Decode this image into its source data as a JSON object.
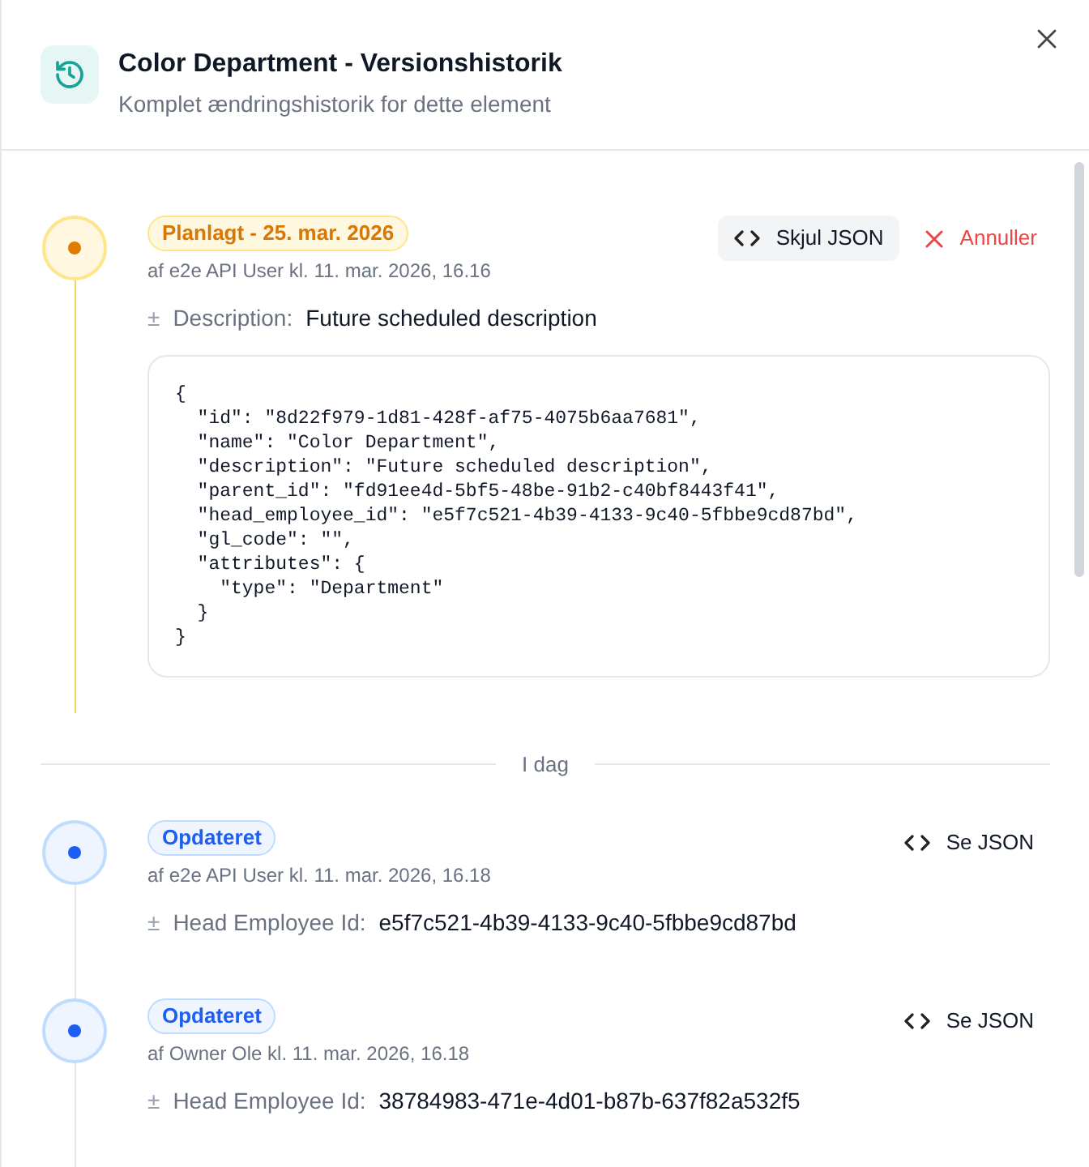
{
  "dialog": {
    "title": "Color Department - Versionshistorik",
    "subtitle": "Komplet ændringshistorik for dette element"
  },
  "timeline": [
    {
      "kind": "scheduled",
      "badge": "Planlagt - 25. mar. 2026",
      "byline": "af e2e API User kl. 11. mar. 2026, 16.16",
      "change_mark": "±",
      "field": "Description:",
      "value": "Future scheduled description",
      "json_button": "Skjul JSON",
      "json_open": true,
      "cancel_button": "Annuller",
      "json_lines": [
        "{",
        "  \"id\": \"8d22f979-1d81-428f-af75-4075b6aa7681\",",
        "  \"name\": \"Color Department\",",
        "  \"description\": \"Future scheduled description\",",
        "  \"parent_id\": \"fd91ee4d-5bf5-48be-91b2-c40bf8443f41\",",
        "  \"head_employee_id\": \"e5f7c521-4b39-4133-9c40-5fbbe9cd87bd\",",
        "  \"gl_code\": \"\",",
        "  \"attributes\": {",
        "    \"type\": \"Department\"",
        "  }",
        "}"
      ]
    },
    {
      "kind": "divider",
      "label": "I dag"
    },
    {
      "kind": "updated",
      "badge": "Opdateret",
      "byline": "af e2e API User kl. 11. mar. 2026, 16.18",
      "change_mark": "±",
      "field": "Head Employee Id:",
      "value": "e5f7c521-4b39-4133-9c40-5fbbe9cd87bd",
      "json_button": "Se JSON",
      "json_open": false
    },
    {
      "kind": "updated",
      "badge": "Opdateret",
      "byline": "af Owner Ole kl. 11. mar. 2026, 16.18",
      "change_mark": "±",
      "field": "Head Employee Id:",
      "value": "38784983-471e-4d01-b87b-637f82a532f5",
      "json_button": "Se JSON",
      "json_open": false
    }
  ]
}
